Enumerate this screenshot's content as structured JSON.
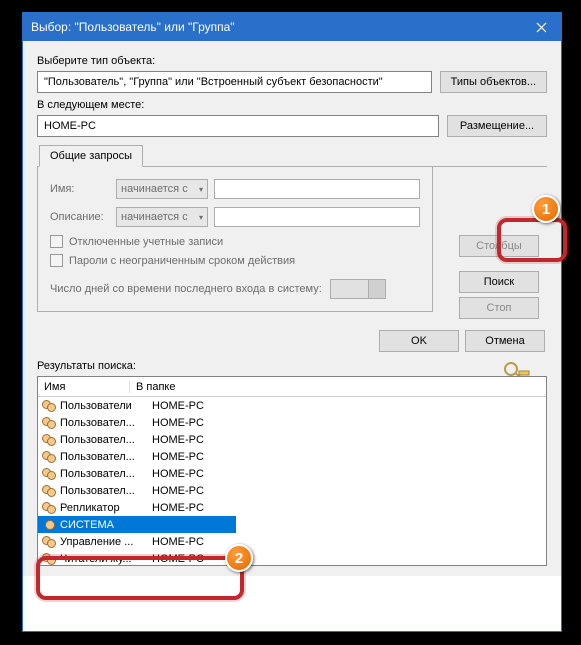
{
  "window": {
    "title": "Выбор: \"Пользователь\" или \"Группа\""
  },
  "labels": {
    "objectType": "Выберите тип объекта:",
    "objectTypeValue": "\"Пользователь\", \"Группа\" или \"Встроенный субъект безопасности\"",
    "location": "В следующем месте:",
    "locationValue": "HOME-PC",
    "resultsLabel": "Результаты поиска:",
    "nameLabel": "Имя:",
    "descLabel": "Описание:",
    "startsWith": "начинается с",
    "disabledAccounts": "Отключенные учетные записи",
    "neverExpire": "Пароли с неограниченным сроком действия",
    "daysSince": "Число дней со времени последнего входа в систему:"
  },
  "buttons": {
    "objectTypes": "Типы объектов...",
    "locations": "Размещение...",
    "columns": "Столбцы",
    "search": "Поиск",
    "stop": "Стоп",
    "ok": "OK",
    "cancel": "Отмена"
  },
  "tabs": {
    "common": "Общие запросы"
  },
  "resultsHeader": {
    "col1": "Имя",
    "col2": "В папке"
  },
  "results": [
    {
      "name": "Пользователи",
      "folder": "HOME-PC",
      "group": true
    },
    {
      "name": "Пользовател...",
      "folder": "HOME-PC",
      "group": true
    },
    {
      "name": "Пользовател...",
      "folder": "HOME-PC",
      "group": true
    },
    {
      "name": "Пользовател...",
      "folder": "HOME-PC",
      "group": true
    },
    {
      "name": "Пользовател...",
      "folder": "HOME-PC",
      "group": true
    },
    {
      "name": "Пользовател...",
      "folder": "HOME-PC",
      "group": true
    },
    {
      "name": "Репликатор",
      "folder": "HOME-PC",
      "group": true
    },
    {
      "name": "СИСТЕМА",
      "folder": "",
      "group": false,
      "selected": true
    },
    {
      "name": "Управление ...",
      "folder": "HOME-PC",
      "group": true
    },
    {
      "name": "Читатели жу...",
      "folder": "HOME-PC",
      "group": true
    }
  ],
  "callouts": {
    "b1": "1",
    "b2": "2"
  }
}
